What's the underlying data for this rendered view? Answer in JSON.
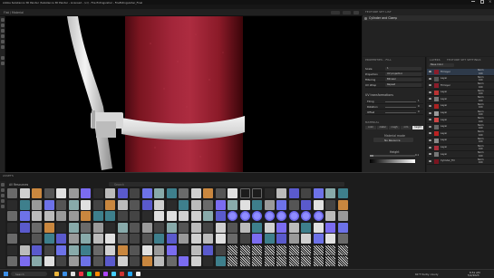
{
  "window": {
    "title": "Adobe Substance 3D Painter (Substance 3D Painter - Licensed - (v)) - Fire Extinguisher - FireExtinguisher_Final"
  },
  "menu": {
    "items": [
      "File",
      "Edit",
      "Mode",
      "Window",
      "Viewport",
      "Plugins",
      "JavaScript",
      "Python",
      "Help"
    ]
  },
  "viewport": {
    "label": "Flat / Material",
    "shading_label": "Material"
  },
  "texture_set_list": {
    "title": "TEXTURE SET LIST",
    "item": "Cylinder and Clamp"
  },
  "properties": {
    "title": "PROPERTIES - FILL",
    "fields": [
      {
        "label": "Scale",
        "value": "1"
      },
      {
        "label": "Projection",
        "value": "UV projection"
      },
      {
        "label": "Filtering",
        "value": "Bilinear"
      },
      {
        "label": "UV Wrap",
        "value": "Repeat"
      }
    ],
    "section_uv": "UV transformations",
    "uv_fields": [
      {
        "label": "Tiling",
        "value": "1"
      },
      {
        "label": "Rotation",
        "value": "0"
      },
      {
        "label": "Offset",
        "value": "0"
      }
    ],
    "material_title": "MATERIAL",
    "channels": [
      "color",
      "metal",
      "rough",
      "nrm",
      "height"
    ],
    "material_mode": "Material mode",
    "no_resource": "No Resource",
    "height_label": "Height",
    "height_value": "0.1"
  },
  "layers": {
    "title": "LAYERS",
    "tab2": "TEXTURE SET SETTINGS",
    "blend": "Base Color",
    "items": [
      {
        "name": "Fill layer",
        "mode": "Norm",
        "opacity": "100"
      },
      {
        "name": "Layer",
        "mode": "Norm",
        "opacity": "100"
      },
      {
        "name": "Fill layer",
        "mode": "Norm",
        "opacity": "100"
      },
      {
        "name": "Layer",
        "mode": "Norm",
        "opacity": "100"
      },
      {
        "name": "Layer",
        "mode": "Norm",
        "opacity": "100"
      },
      {
        "name": "Layer",
        "mode": "Norm",
        "opacity": "100"
      },
      {
        "name": "Layer",
        "mode": "Norm",
        "opacity": "100"
      },
      {
        "name": "Layer",
        "mode": "Norm",
        "opacity": "100"
      },
      {
        "name": "Layer",
        "mode": "Norm",
        "opacity": "100"
      },
      {
        "name": "Layer",
        "mode": "Norm",
        "opacity": "100"
      },
      {
        "name": "Layer",
        "mode": "Norm",
        "opacity": "100"
      },
      {
        "name": "Layer",
        "mode": "Norm",
        "opacity": "100"
      },
      {
        "name": "Layer",
        "mode": "Norm",
        "opacity": "100"
      },
      {
        "name": "Cylinder_Fill",
        "mode": "Norm",
        "opacity": "100"
      }
    ]
  },
  "shelf": {
    "title": "ASSETS",
    "filter": "All Resources",
    "search_placeholder": "Search"
  },
  "taskbar": {
    "search_placeholder": "Search",
    "weather": "84°F  Partly cloudy",
    "time": "8:51 AM",
    "date": "5/2/2023"
  },
  "colors": {
    "accent": "#2f7ad1",
    "cylinder": "#9e1e2c",
    "panel": "#242424",
    "background": "#1d1d1d"
  }
}
